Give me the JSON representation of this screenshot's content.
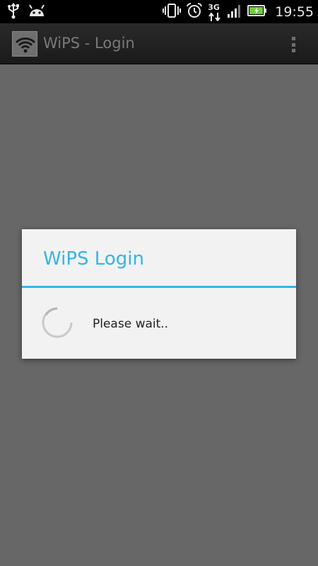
{
  "status_bar": {
    "time": "19:55",
    "network_type": "3G",
    "icons": [
      "usb-icon",
      "android-icon",
      "vibrate-icon",
      "alarm-icon",
      "3g-icon",
      "signal-icon",
      "battery-charging-icon"
    ]
  },
  "action_bar": {
    "title": "WiPS - Login",
    "app_icon": "wifi-icon",
    "menu_icon": "overflow-menu-icon"
  },
  "dialog": {
    "title": "WiPS Login",
    "message": "Please wait..",
    "accent_color": "#33b5e5"
  },
  "colors": {
    "background": "#676767",
    "status_bar": "#000000",
    "battery": "#6ad036"
  }
}
